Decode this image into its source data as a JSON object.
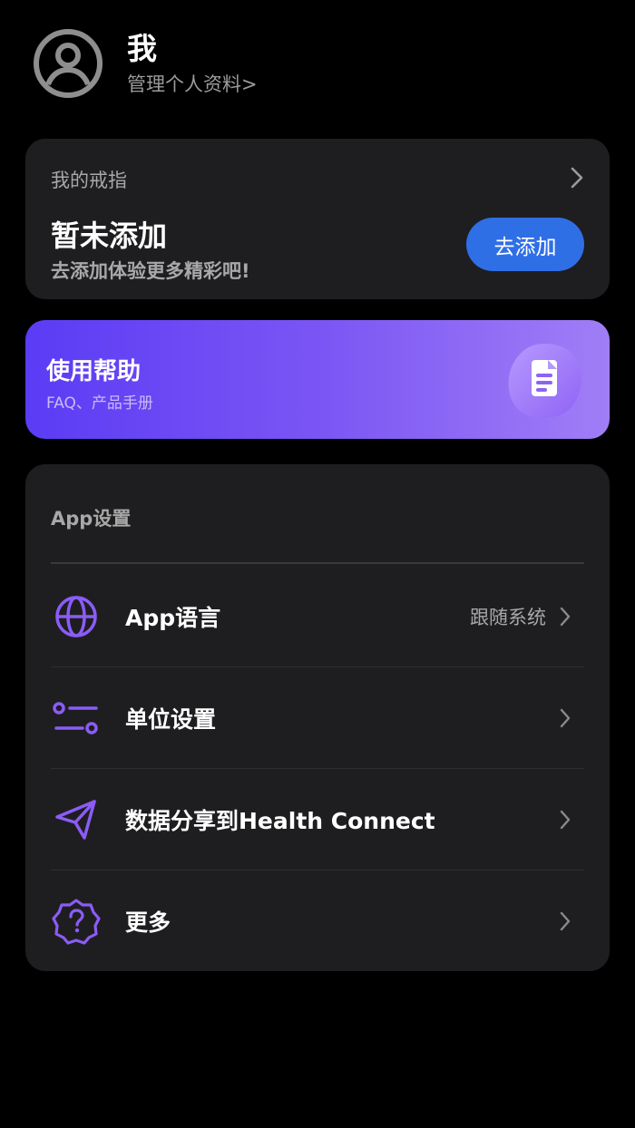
{
  "profile": {
    "name": "我",
    "manage_link": "管理个人资料>"
  },
  "ring": {
    "title": "我的戒指",
    "status": "暂未添加",
    "hint": "去添加体验更多精彩吧!",
    "add_button": "去添加"
  },
  "help": {
    "title": "使用帮助",
    "subtitle": "FAQ、产品手册",
    "icon": "document-icon"
  },
  "settings": {
    "header": "App设置",
    "items": [
      {
        "label": "App语言",
        "value": "跟随系统",
        "icon": "globe-icon"
      },
      {
        "label": "单位设置",
        "value": "",
        "icon": "sliders-icon"
      },
      {
        "label": "数据分享到Health Connect",
        "value": "",
        "icon": "send-icon"
      },
      {
        "label": "更多",
        "value": "",
        "icon": "help-badge-icon"
      }
    ]
  },
  "colors": {
    "background": "#000000",
    "card": "#1e1e20",
    "accent_blue": "#2f6fe6",
    "accent_purple": "#8b5cf6",
    "muted_text": "#a8a8a8"
  }
}
